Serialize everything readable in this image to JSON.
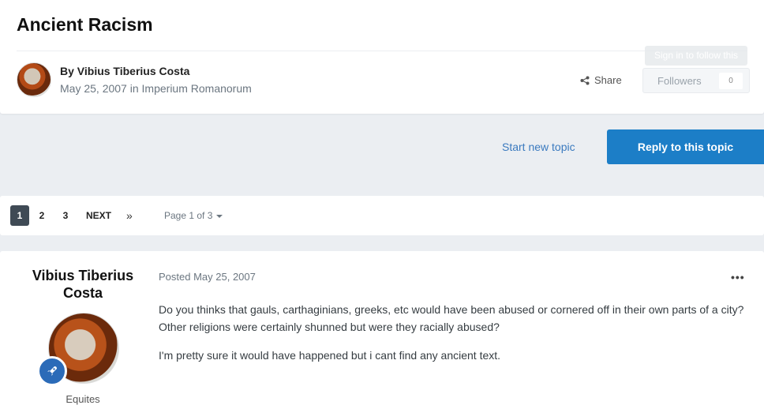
{
  "topic": {
    "title": "Ancient Racism",
    "author_line": "By Vibius Tiberius Costa",
    "date": "May 25, 2007",
    "in_word": "in",
    "forum": "Imperium Romanorum"
  },
  "actions": {
    "share_label": "Share",
    "follow_tooltip": "Sign in to follow this",
    "followers_label": "Followers",
    "followers_count": "0",
    "start_topic_label": "Start new topic",
    "reply_label": "Reply to this topic"
  },
  "pagination": {
    "pages": [
      "1",
      "2",
      "3"
    ],
    "current": "1",
    "next_label": "NEXT",
    "last_label": "»",
    "jump_label": "Page 1 of 3"
  },
  "post": {
    "author_name": "Vibius Tiberius Costa",
    "rank": "Equites",
    "posted": "Posted May 25, 2007",
    "menu": "•••",
    "paragraphs": [
      "Do you thinks that gauls, carthaginians, greeks, etc would have been abused or cornered off in their own parts of a city? Other religions were certainly shunned but were they racially abused?",
      "I'm pretty sure it would have happened but i cant find any ancient text."
    ]
  },
  "colors": {
    "accent": "#1c7ec7",
    "link": "#3b7abf",
    "badge": "#2b6bb8",
    "page_active": "#3f4a55"
  },
  "icons": {
    "share": "share-icon",
    "rank_badge": "rocket-icon",
    "post_menu": "ellipsis-icon",
    "dropdown": "caret-down-icon"
  }
}
